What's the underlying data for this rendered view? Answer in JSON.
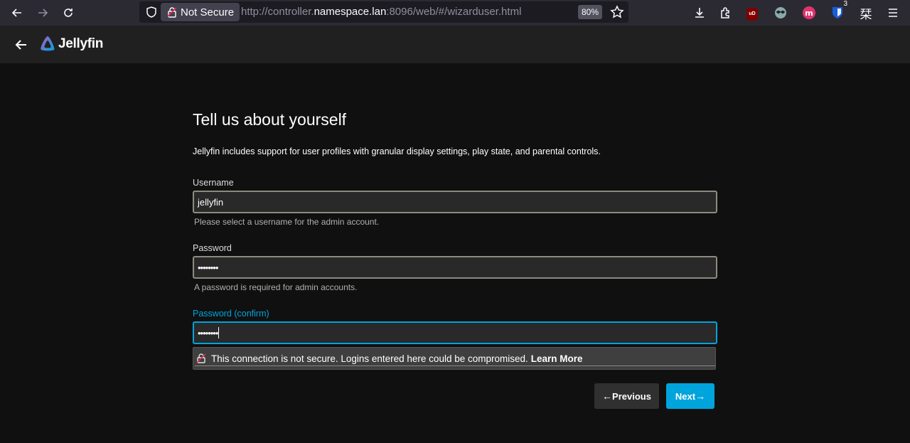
{
  "browser": {
    "security_label": "Not Secure",
    "url_prefix": "http://controller.",
    "url_host": "namespace.lan",
    "url_suffix": ":8096/web/#/wizarduser.html",
    "zoom": "80%",
    "extension_badge": "3",
    "ext_ublock_label": "uD",
    "ext_kanji": "栞"
  },
  "app": {
    "name": "Jellyfin"
  },
  "form": {
    "title": "Tell us about yourself",
    "description": "Jellyfin includes support for user profiles with granular display settings, play state, and parental controls.",
    "username_label": "Username",
    "username_value": "jellyfin",
    "username_help": "Please select a username for the admin account.",
    "password_label": "Password",
    "password_value": "••••••••",
    "password_help": "A password is required for admin accounts.",
    "confirm_label": "Password (confirm)",
    "confirm_value": "••••••••"
  },
  "insecure_warning": {
    "message": "This connection is not secure. Logins entered here could be compromised.",
    "link": "Learn More"
  },
  "buttons": {
    "previous": "Previous",
    "next": "Next"
  },
  "colors": {
    "accent": "#00a4dc",
    "background": "#101010",
    "header": "#202020"
  }
}
